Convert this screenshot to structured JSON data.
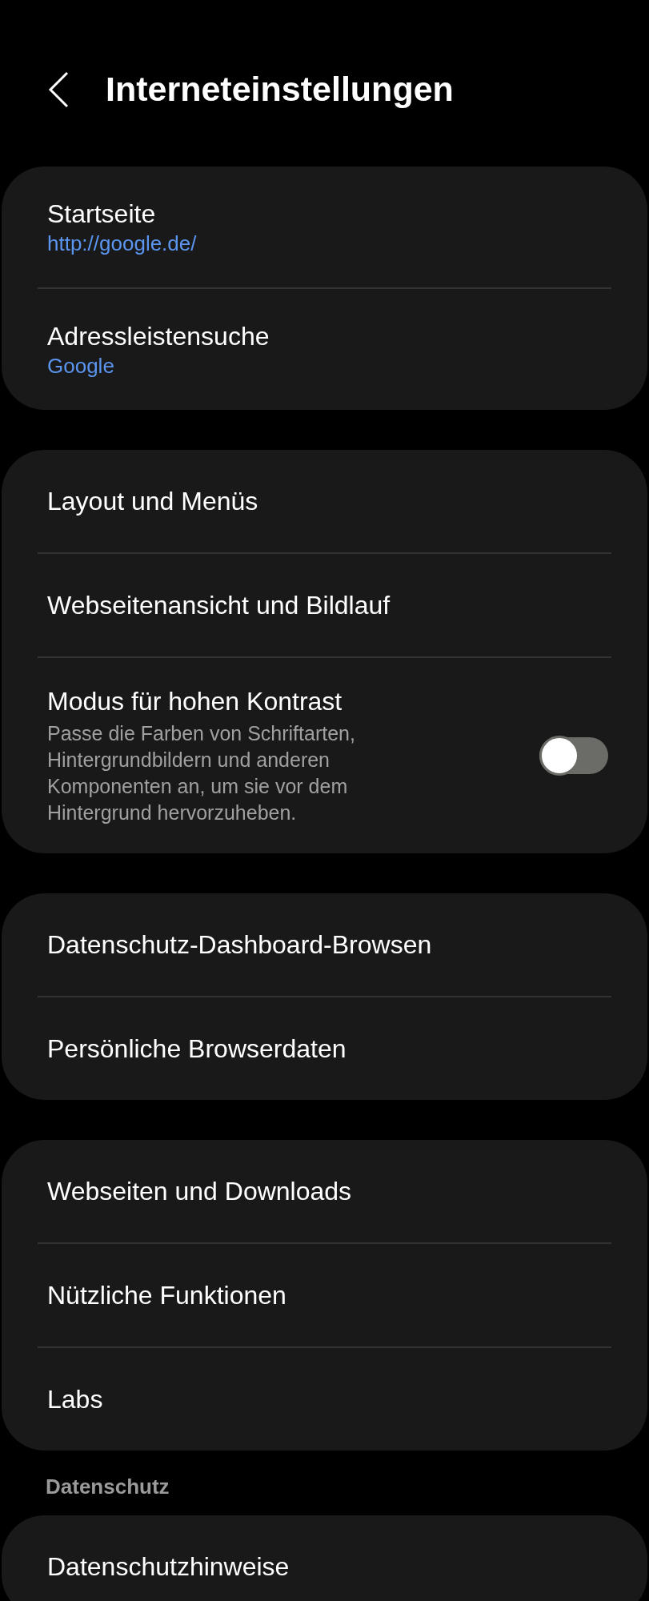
{
  "header": {
    "title": "Interneteinstellungen"
  },
  "groups": [
    {
      "items": [
        {
          "kind": "value",
          "title": "Startseite",
          "value": "http://google.de/"
        },
        {
          "kind": "value",
          "title": "Adressleistensuche",
          "value": "Google"
        }
      ]
    },
    {
      "items": [
        {
          "kind": "plain",
          "title": "Layout und Menüs"
        },
        {
          "kind": "plain",
          "title": "Webseitenansicht und Bildlauf"
        },
        {
          "kind": "toggle",
          "title": "Modus für hohen Kontrast",
          "description": "Passe die Farben von Schriftarten, Hintergrundbildern und anderen Komponenten an, um sie vor dem Hintergrund hervorzuheben.",
          "on": false
        }
      ]
    },
    {
      "items": [
        {
          "kind": "plain",
          "title": "Datenschutz-Dashboard-Browsen"
        },
        {
          "kind": "plain",
          "title": "Persönliche Browserdaten"
        }
      ]
    },
    {
      "items": [
        {
          "kind": "plain",
          "title": "Webseiten und Downloads"
        },
        {
          "kind": "plain",
          "title": "Nützliche Funktionen"
        },
        {
          "kind": "plain",
          "title": "Labs"
        }
      ]
    },
    {
      "label": "Datenschutz",
      "items": [
        {
          "kind": "plain",
          "title": "Datenschutzhinweise"
        }
      ]
    }
  ]
}
